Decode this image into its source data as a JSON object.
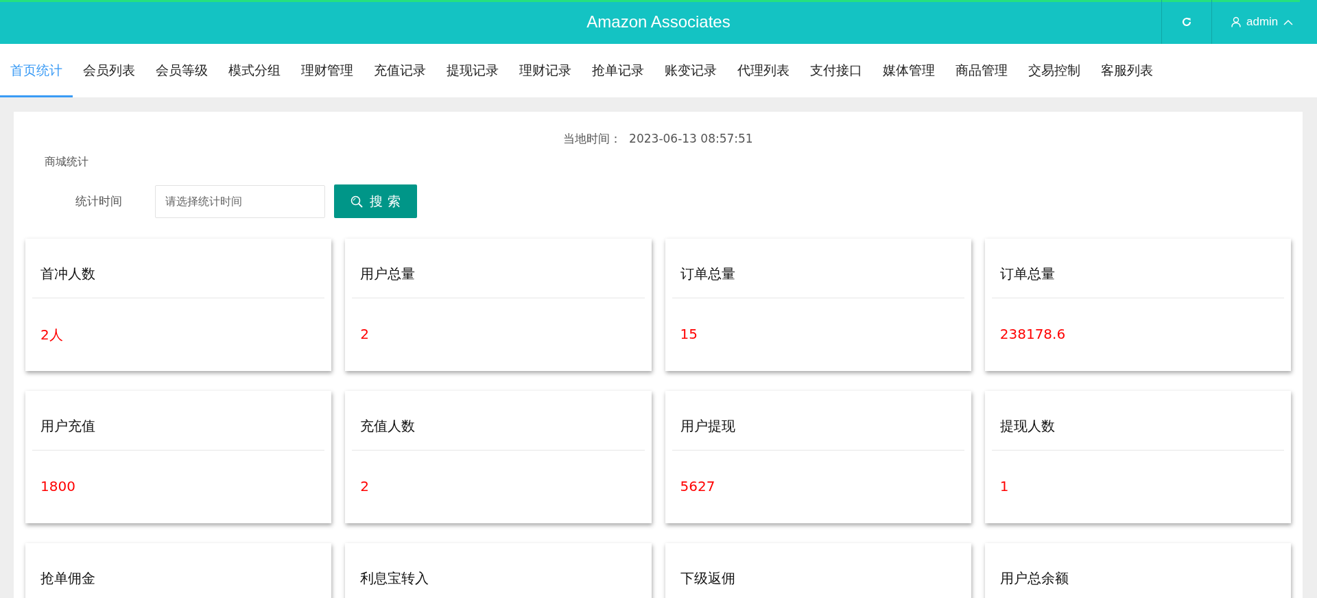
{
  "header": {
    "title": "Amazon Associates",
    "user": "admin"
  },
  "tabs": [
    {
      "label": "首页统计",
      "selected": true
    },
    {
      "label": "会员列表",
      "selected": false
    },
    {
      "label": "会员等级",
      "selected": false
    },
    {
      "label": "模式分组",
      "selected": false
    },
    {
      "label": "理财管理",
      "selected": false
    },
    {
      "label": "充值记录",
      "selected": false
    },
    {
      "label": "提现记录",
      "selected": false
    },
    {
      "label": "理财记录",
      "selected": false
    },
    {
      "label": "抢单记录",
      "selected": false
    },
    {
      "label": "账变记录",
      "selected": false
    },
    {
      "label": "代理列表",
      "selected": false
    },
    {
      "label": "支付接口",
      "selected": false
    },
    {
      "label": "媒体管理",
      "selected": false
    },
    {
      "label": "商品管理",
      "selected": false
    },
    {
      "label": "交易控制",
      "selected": false
    },
    {
      "label": "客服列表",
      "selected": false
    }
  ],
  "local_time": {
    "label": "当地时间：",
    "value": "2023-06-13 08:57:51"
  },
  "section_title": "商城统计",
  "filter": {
    "label": "统计时间",
    "placeholder": "请选择统计时间",
    "button": "搜 索"
  },
  "stats": [
    {
      "title": "首冲人数",
      "value": "2人"
    },
    {
      "title": "用户总量",
      "value": "2"
    },
    {
      "title": "订单总量",
      "value": "15"
    },
    {
      "title": "订单总量",
      "value": "238178.6"
    },
    {
      "title": "用户充值",
      "value": "1800"
    },
    {
      "title": "充值人数",
      "value": "2"
    },
    {
      "title": "用户提现",
      "value": "5627"
    },
    {
      "title": "提现人数",
      "value": "1"
    },
    {
      "title": "抢单佣金"
    },
    {
      "title": "利息宝转入"
    },
    {
      "title": "下级返佣"
    },
    {
      "title": "用户总余额"
    }
  ]
}
